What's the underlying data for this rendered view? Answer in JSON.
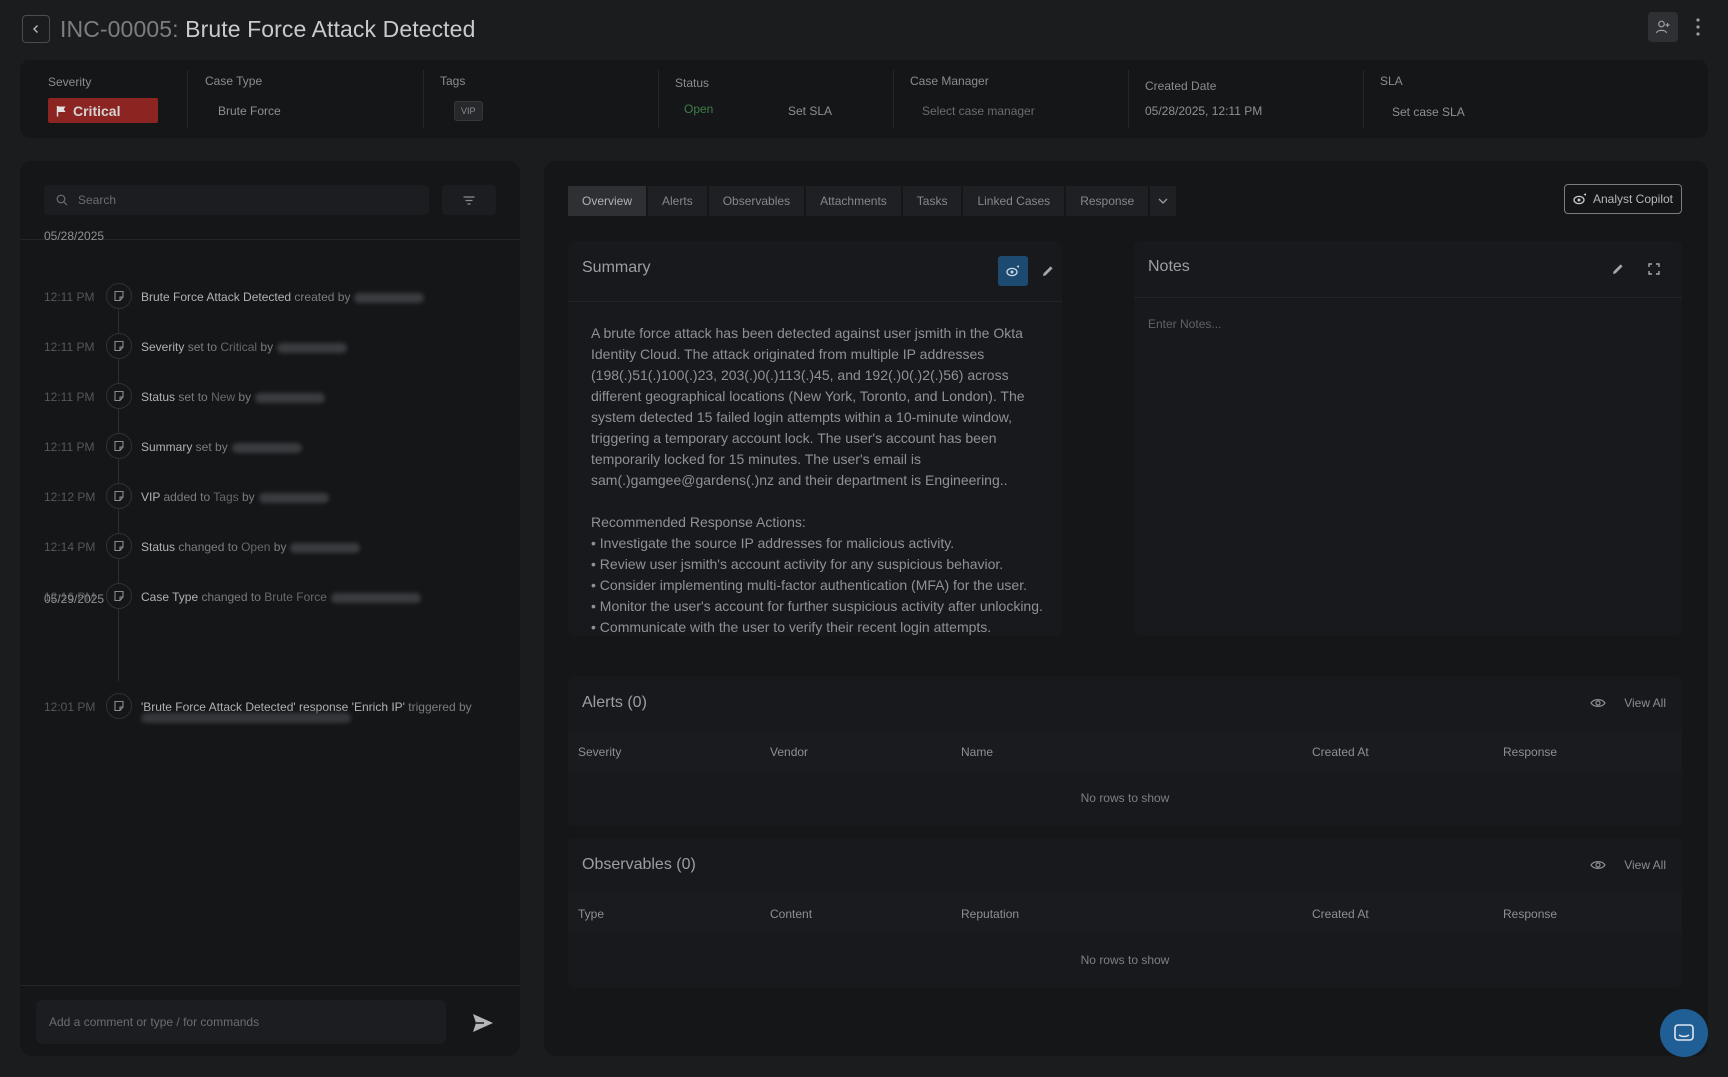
{
  "header": {
    "incident_id": "INC-00005:",
    "incident_title": "Brute Force Attack Detected"
  },
  "infobar": {
    "severity_label": "Severity",
    "severity_value": "Critical",
    "case_type_label": "Case Type",
    "case_type_value": "Brute Force",
    "tags_label": "Tags",
    "tag_vip": "VIP",
    "status_label": "Status",
    "status_value": "Open",
    "set_sla": "Set SLA",
    "case_manager_label": "Case Manager",
    "case_manager_placeholder": "Select case manager",
    "created_date_label": "Created Date",
    "created_date_value": "05/28/2025, 12:11 PM",
    "sla_label": "SLA",
    "sla_value": "Set case SLA"
  },
  "timeline": {
    "search_placeholder": "Search",
    "groups": [
      {
        "date": "05/28/2025",
        "events": [
          {
            "time": "12:11 PM",
            "a": "Brute Force Attack Detected",
            "b": " created by",
            "c": ""
          },
          {
            "time": "12:11 PM",
            "a": "Severity",
            "b": " set to ",
            "c": "Critical",
            "d": " by"
          },
          {
            "time": "12:11 PM",
            "a": "Status",
            "b": " set to ",
            "c": "New",
            "d": " by"
          },
          {
            "time": "12:11 PM",
            "a": "Summary",
            "b": " set by",
            "c": ""
          },
          {
            "time": "12:12 PM",
            "a": "VIP",
            "b": " added to ",
            "c": "Tags",
            "d": " by"
          },
          {
            "time": "12:14 PM",
            "a": "Status",
            "b": " changed to ",
            "c": "Open",
            "d": " by"
          },
          {
            "time": "12:16 PM",
            "a": "Case Type",
            "b": " changed to ",
            "c": "Brute Force",
            "d": ""
          }
        ]
      },
      {
        "date": "05/29/2025",
        "events": [
          {
            "time": "12:01 PM",
            "a": "'Brute Force Attack Detected' response 'Enrich IP'",
            "b": " triggered by",
            "c": ""
          }
        ]
      }
    ],
    "comment_placeholder": "Add a comment or type / for commands"
  },
  "tabs": [
    "Overview",
    "Alerts",
    "Observables",
    "Attachments",
    "Tasks",
    "Linked Cases",
    "Response"
  ],
  "copilot_label": "Analyst Copilot",
  "summary": {
    "title": "Summary",
    "paragraph": "A brute force attack has been detected against user jsmith in the Okta Identity Cloud. The attack originated from multiple IP addresses (198(.)51(.)100(.)23, 203(.)0(.)113(.)45, and 192(.)0(.)2(.)56) across different geographical locations (New York, Toronto, and London). The system detected 15 failed login attempts within a 10-minute window, triggering a temporary account lock. The user's account has been temporarily locked for 15 minutes. The user's email is sam(.)gamgee@gardens(.)nz and their department is Engineering..",
    "actions_heading": "Recommended Response Actions:",
    "actions": [
      "• Investigate the source IP addresses for malicious activity.",
      "• Review user jsmith's account activity for any suspicious behavior.",
      "• Consider implementing multi-factor authentication (MFA) for the user.",
      "• Monitor the user's account for further suspicious activity after unlocking.",
      "• Communicate with the user to verify their recent login attempts."
    ]
  },
  "notes": {
    "title": "Notes",
    "placeholder": "Enter Notes..."
  },
  "alerts": {
    "title": "Alerts (0)",
    "view_all": "View All",
    "columns": [
      "Severity",
      "Vendor",
      "Name",
      "Created At",
      "Response"
    ],
    "empty": "No rows to show"
  },
  "observables": {
    "title": "Observables (0)",
    "view_all": "View All",
    "columns": [
      "Type",
      "Content",
      "Reputation",
      "Created At",
      "Response"
    ],
    "empty": "No rows to show"
  },
  "colors": {
    "critical": "#8c2521",
    "open_status": "#3c7f4a",
    "accent_blue": "#1f5f96"
  }
}
